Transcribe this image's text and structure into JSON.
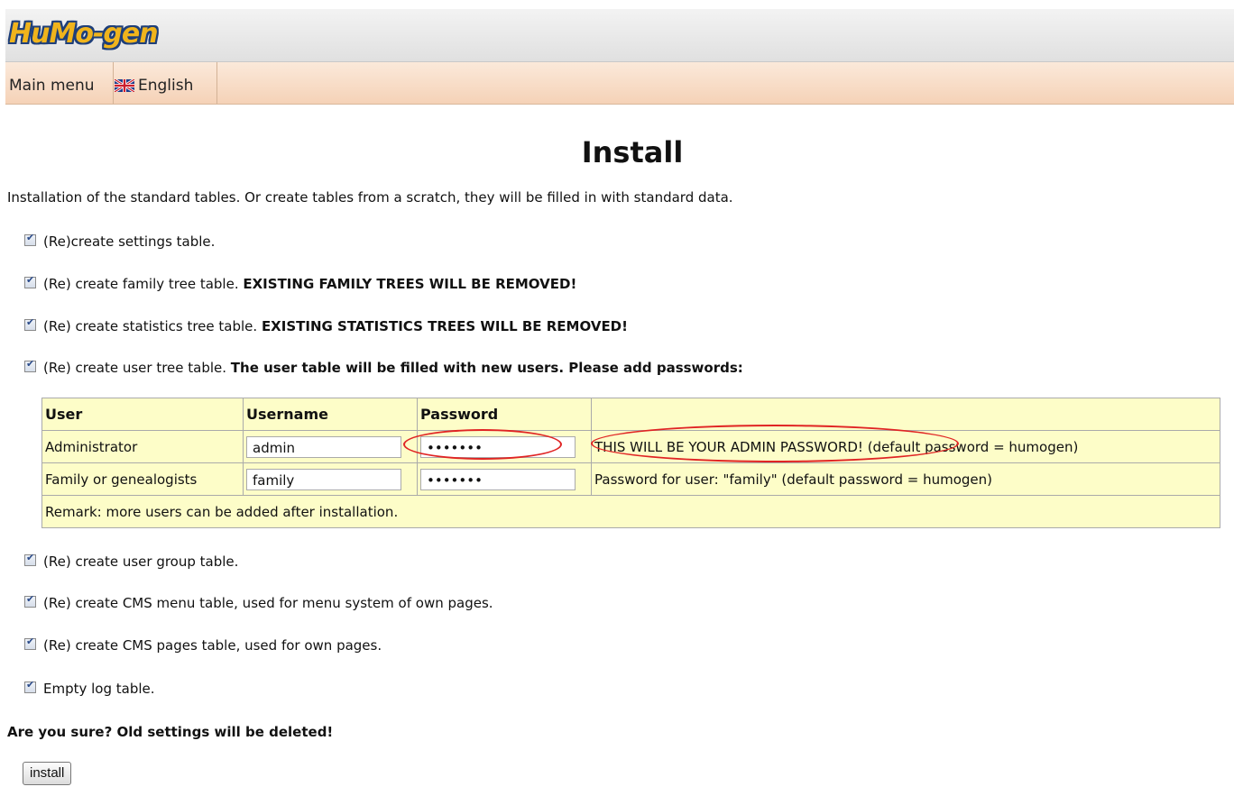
{
  "header": {
    "logo": "HuMo-gen"
  },
  "menu": {
    "main": "Main menu",
    "language": "English",
    "flag_icon": "uk-flag-icon"
  },
  "page": {
    "title": "Install",
    "intro": "Installation of the standard tables. Or create tables from a scratch, they will be filled in with standard data."
  },
  "options": [
    {
      "text": "(Re)create settings table.",
      "bold": ""
    },
    {
      "text": "(Re) create family tree table. ",
      "bold": "EXISTING FAMILY TREES WILL BE REMOVED!"
    },
    {
      "text": "(Re) create statistics tree table. ",
      "bold": "EXISTING STATISTICS TREES WILL BE REMOVED!"
    },
    {
      "text": "(Re) create user tree table. ",
      "bold": "The user table will be filled with new users. Please add passwords:"
    },
    {
      "text": "(Re) create user group table.",
      "bold": ""
    },
    {
      "text": "(Re) create CMS menu table, used for menu system of own pages.",
      "bold": ""
    },
    {
      "text": "(Re) create CMS pages table, used for own pages.",
      "bold": ""
    },
    {
      "text": "Empty log table.",
      "bold": ""
    }
  ],
  "user_table": {
    "headers": [
      "User",
      "Username",
      "Password"
    ],
    "rows": [
      {
        "user": "Administrator",
        "username": "admin",
        "password": "•••••••",
        "note": "THIS WILL BE YOUR ADMIN PASSWORD! (default password = humogen)"
      },
      {
        "user": "Family or genealogists",
        "username": "family",
        "password": "•••••••",
        "note": "Password for user: \"family\" (default password = humogen)"
      }
    ],
    "remark": "Remark: more users can be added after installation."
  },
  "confirm": "Are you sure? Old settings will be deleted!",
  "install_button": "install"
}
